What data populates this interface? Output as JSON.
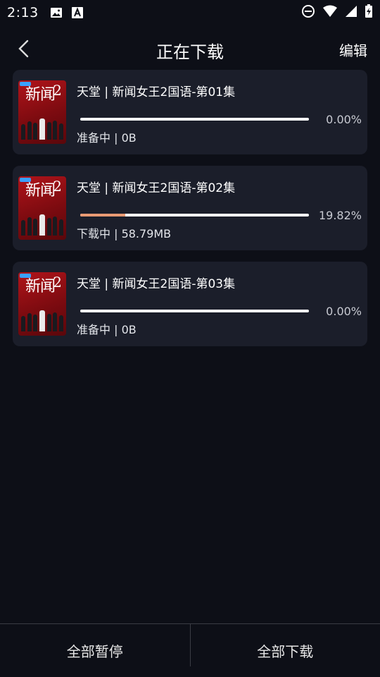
{
  "status_bar": {
    "time": "2:13"
  },
  "header": {
    "title": "正在下载",
    "edit_label": "编辑"
  },
  "downloads": [
    {
      "title": "天堂 | 新闻女王2国语-第01集",
      "progress_percent": 0.0,
      "percent_text": "0.00%",
      "status": "准备中 | 0B"
    },
    {
      "title": "天堂 | 新闻女王2国语-第02集",
      "progress_percent": 19.82,
      "percent_text": "19.82%",
      "status": "下载中 | 58.79MB"
    },
    {
      "title": "天堂 | 新闻女王2国语-第03集",
      "progress_percent": 0.0,
      "percent_text": "0.00%",
      "status": "准备中 | 0B"
    }
  ],
  "thumbnail": {
    "big_text": "新闻",
    "num": "2"
  },
  "bottom": {
    "pause_all": "全部暂停",
    "download_all": "全部下载"
  },
  "colors": {
    "background": "#0d0f17",
    "card": "#1b1e2a",
    "progress_fill": "#e89a74",
    "progress_track": "#ffffff"
  }
}
